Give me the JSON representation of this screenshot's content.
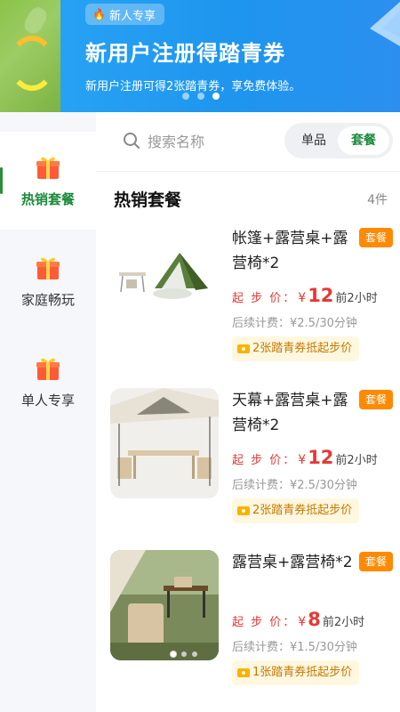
{
  "banner": {
    "badge": "新人专享",
    "title": "新用户注册得踏青券",
    "subtitle": "新用户注册可得2张踏青券，享免费体验。",
    "dots": 3,
    "active_dot": 2
  },
  "sidebar": {
    "items": [
      {
        "label": "热销套餐",
        "icon": "gift-icon",
        "active": true
      },
      {
        "label": "家庭畅玩",
        "icon": "gift-icon",
        "active": false
      },
      {
        "label": "单人专享",
        "icon": "gift-icon",
        "active": false
      }
    ]
  },
  "search": {
    "placeholder": "搜索名称"
  },
  "segment": {
    "options": [
      "单品",
      "套餐"
    ],
    "selected": "套餐"
  },
  "section": {
    "title": "热销套餐",
    "count": "4件"
  },
  "products": [
    {
      "title": "帐篷+露营桌+露营椅*2",
      "tag": "套餐",
      "price_label": "起 步 价：",
      "currency": "¥",
      "price": "12",
      "price_unit": "前2小时",
      "follow_fee": "后续计费：¥2.5/30分钟",
      "coupon": "2张踏青券抵起步价"
    },
    {
      "title": "天幕+露营桌+露营椅*2",
      "tag": "套餐",
      "price_label": "起 步 价：",
      "currency": "¥",
      "price": "12",
      "price_unit": "前2小时",
      "follow_fee": "后续计费：¥2.5/30分钟",
      "coupon": "2张踏青券抵起步价"
    },
    {
      "title": "露营桌+露营椅*2",
      "tag": "套餐",
      "price_label": "起 步 价：",
      "currency": "¥",
      "price": "8",
      "price_unit": "前2小时",
      "follow_fee": "后续计费：¥1.5/30分钟",
      "coupon": "1张踏青券抵起步价"
    }
  ],
  "colors": {
    "accent": "#1a8a3a",
    "banner": "#1e95ee",
    "price": "#e53935",
    "tag": "#ff8a00"
  }
}
